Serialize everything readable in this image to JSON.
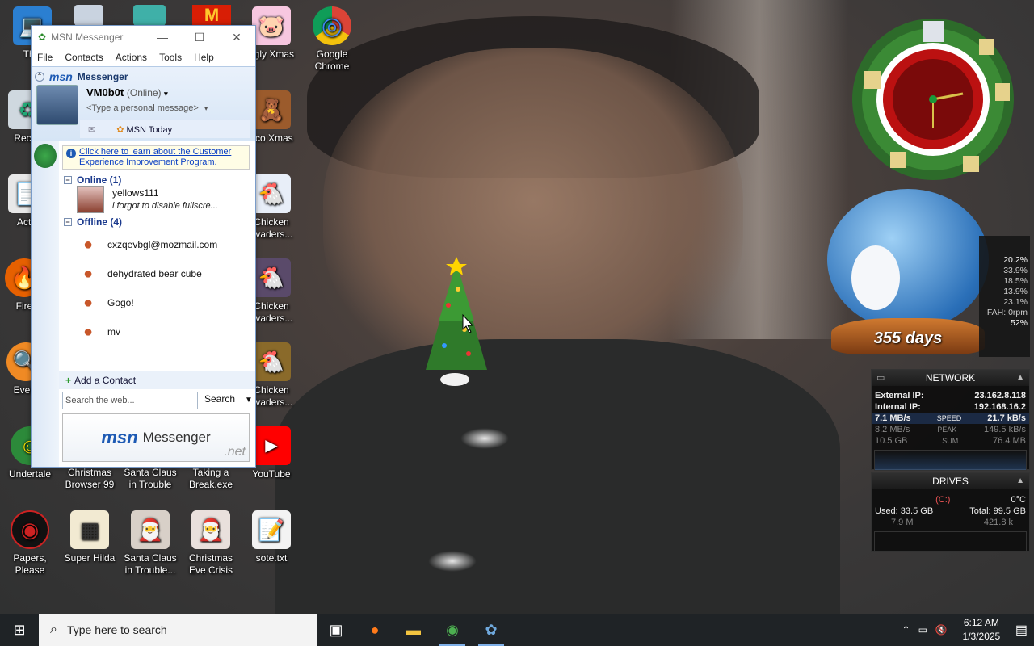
{
  "desktop": {
    "icons": [
      {
        "label": "This",
        "glyph": "💻"
      },
      {
        "label": "Recyc",
        "glyph": "♻"
      },
      {
        "label": "Activ",
        "glyph": "📄"
      },
      {
        "label": "Fire",
        "glyph": "🔥"
      },
      {
        "label": "Every",
        "glyph": "🔍"
      },
      {
        "label": "Undertale",
        "glyph": "☺"
      },
      {
        "label": "Papers, Please",
        "glyph": "◉"
      },
      {
        "label": "Super Hilda",
        "glyph": "▦"
      },
      {
        "label": "Santa Claus in Trouble...",
        "glyph": "🎅"
      },
      {
        "label": "Christmas Eve Crisis",
        "glyph": "🎅"
      },
      {
        "label": "sote.txt",
        "glyph": "📝"
      },
      {
        "label": "Christmas Browser 99",
        "glyph": ""
      },
      {
        "label": "Santa Claus in Trouble",
        "glyph": ""
      },
      {
        "label": "Taking a Break.exe",
        "glyph": ""
      },
      {
        "label": "YouTube",
        "glyph": "▶"
      },
      {
        "label": "Google Chrome",
        "glyph": "◎"
      },
      {
        "label": "ggly Xmas",
        "glyph": "🐷"
      },
      {
        "label": "oco Xmas",
        "glyph": "🧸"
      },
      {
        "label": "Chicken nvaders...",
        "glyph": "🐔"
      },
      {
        "label": "Chicken nvaders...",
        "glyph": "🐔"
      },
      {
        "label": "Chicken nvaders...",
        "glyph": "🐔"
      }
    ]
  },
  "msn": {
    "window_title": "MSN Messenger",
    "menu": [
      "File",
      "Contacts",
      "Actions",
      "Tools",
      "Help"
    ],
    "brand": "msn",
    "brand_sub": "Messenger",
    "username": "VM0b0t",
    "status": "(Online)",
    "personal_message_placeholder": "<Type a personal message>",
    "msn_today": "MSN Today",
    "info_link": "Click here to learn about the Customer Experience Improvement Program.",
    "groups": [
      {
        "label": "Online (1)"
      },
      {
        "label": "Offline (4)"
      }
    ],
    "online_contacts": [
      {
        "name": "yellows111",
        "message": "i forgot to disable fullscre..."
      }
    ],
    "offline_contacts": [
      {
        "name": "cxzqevbgl@mozmail.com"
      },
      {
        "name": "dehydrated bear cube"
      },
      {
        "name": "Gogo!"
      },
      {
        "name": "mv"
      }
    ],
    "add_contact": "Add a Contact",
    "search_placeholder": "Search the web...",
    "search_button": "Search",
    "banner": {
      "brand": "msn",
      "product": "Messenger",
      "suffix": ".net"
    }
  },
  "widgets": {
    "globe_text": "355 days",
    "cpu": [
      "20.2%",
      "33.9%",
      "18.5%",
      "13.9%",
      "23.1%",
      "FAH: 0rpm",
      "52%"
    ],
    "network": {
      "title": "NETWORK",
      "external_ip_label": "External IP:",
      "external_ip": "23.162.8.118",
      "internal_ip_label": "Internal IP:",
      "internal_ip": "192.168.16.2",
      "down_speed": "7.1 MB/s",
      "speed_label": "SPEED",
      "up_speed": "21.7 kB/s",
      "down_peak": "8.2 MB/s",
      "peak_label": "PEAK",
      "up_peak": "149.5 kB/s",
      "down_sum": "10.5 GB",
      "sum_label": "SUM",
      "up_sum": "76.4 MB"
    },
    "drives": {
      "title": "DRIVES",
      "drive": "(C:)",
      "temp": "0°C",
      "used": "Used: 33.5 GB",
      "total": "Total: 99.5 GB",
      "read": "7.9 M",
      "write": "421.8 k"
    }
  },
  "taskbar": {
    "search_placeholder": "Type here to search",
    "time": "6:12 AM",
    "date": "1/3/2025"
  }
}
